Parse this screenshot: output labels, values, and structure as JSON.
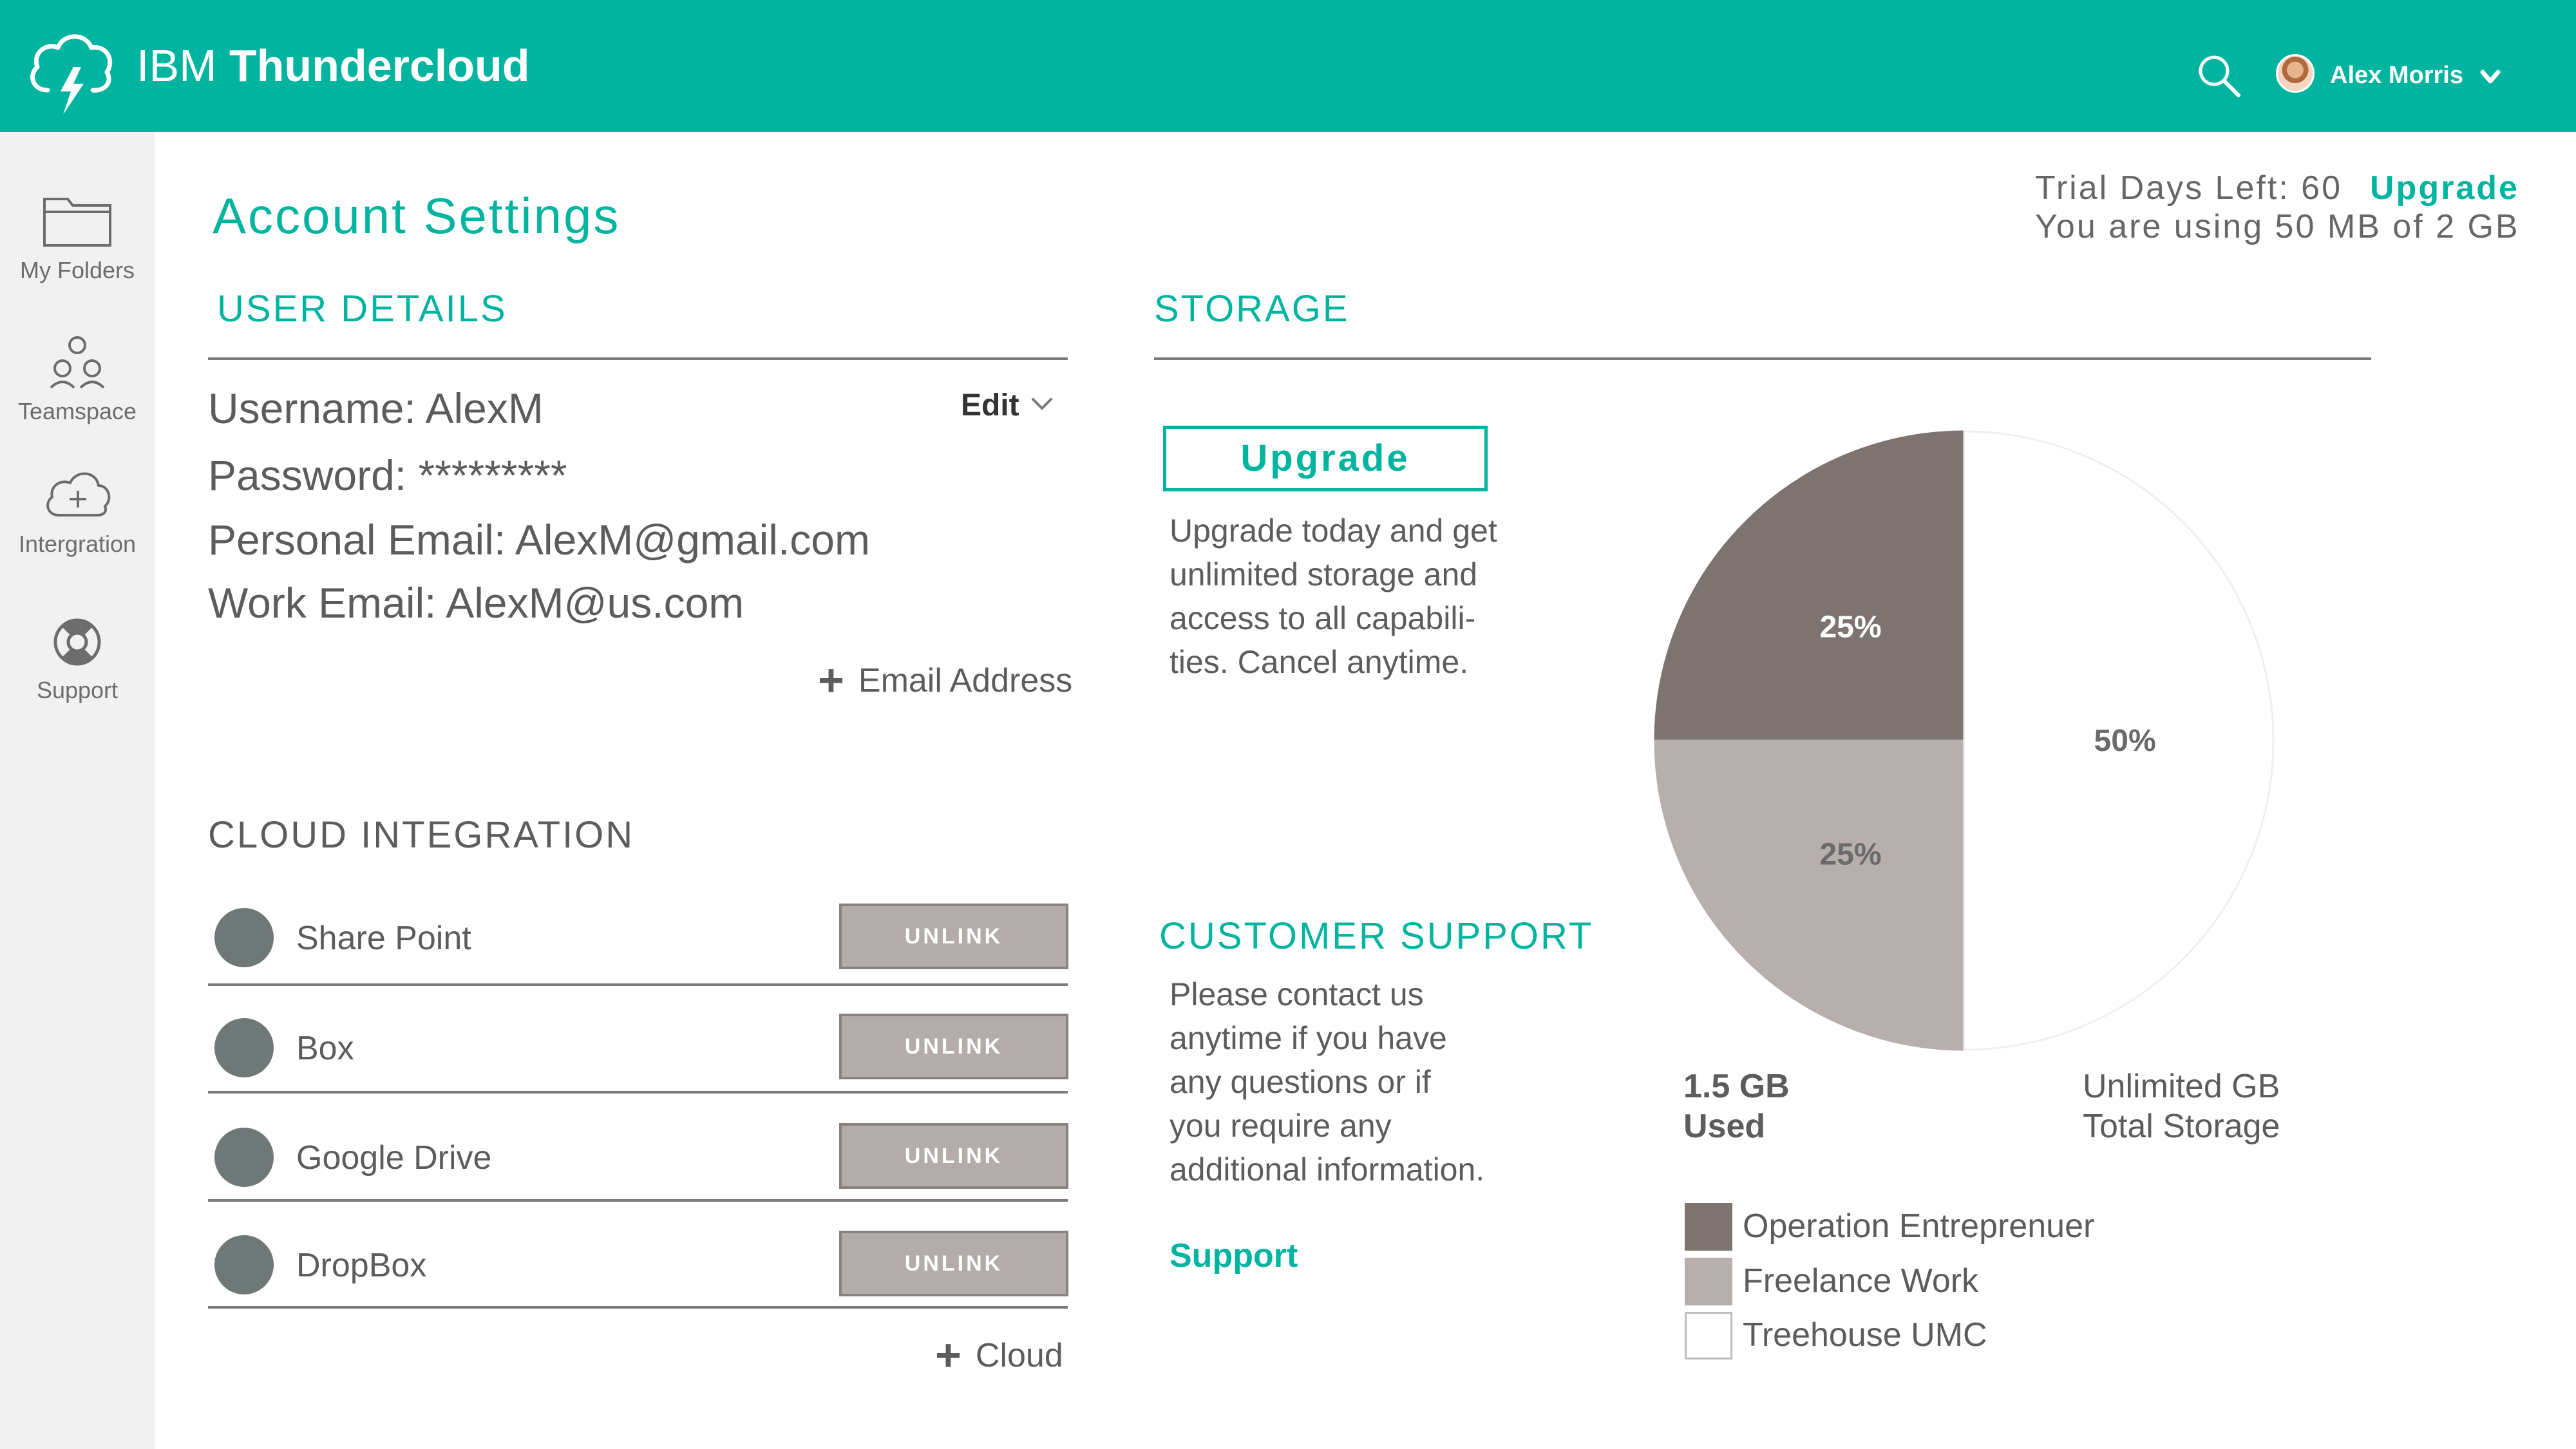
{
  "app": {
    "brand_light": "IBM",
    "brand_bold": "Thundercloud",
    "user_name": "Alex Morris",
    "accent_color": "#00b4a0"
  },
  "sidebar": {
    "items": [
      {
        "label": "My Folders",
        "icon": "folder-icon"
      },
      {
        "label": "Teamspace",
        "icon": "team-icon"
      },
      {
        "label": "Intergration",
        "icon": "cloud-plus-icon"
      },
      {
        "label": "Support",
        "icon": "lifebuoy-icon"
      }
    ]
  },
  "page": {
    "title": "Account Settings",
    "trial_label": "Trial Days Left: 60",
    "trial_upgrade": "Upgrade",
    "usage": "You are using 50 MB of 2 GB"
  },
  "user_details": {
    "title": "USER DETAILS",
    "edit_label": "Edit",
    "username": "Username: AlexM",
    "password": "Password: *********",
    "personal_email": "Personal Email: AlexM@gmail.com",
    "work_email": "Work Email: AlexM@us.com",
    "add_email": "Email Address"
  },
  "cloud_integration": {
    "title": "CLOUD INTEGRATION",
    "items": [
      {
        "name": "Share Point",
        "action": "UNLINK"
      },
      {
        "name": "Box",
        "action": "UNLINK"
      },
      {
        "name": "Google Drive",
        "action": "UNLINK"
      },
      {
        "name": "DropBox",
        "action": "UNLINK"
      }
    ],
    "add_cloud": "Cloud"
  },
  "storage": {
    "title": "STORAGE",
    "upgrade_button": "Upgrade",
    "upgrade_text": "Upgrade today and get\nunlimited storage and\naccess to all capabili-\nties. Cancel anytime.",
    "used_value": "1.5 GB",
    "used_label": "Used",
    "total_value": "Unlimited GB",
    "total_label": "Total Storage"
  },
  "customer_support": {
    "title": "CUSTOMER SUPPORT",
    "text": "Please contact us\nanytime if you have\nany questions or if\nyou require any\nadditional information.",
    "link": "Support"
  },
  "chart_data": {
    "type": "pie",
    "title": "",
    "series": [
      {
        "name": "Operation Entreprenuer",
        "value": 25,
        "label": "25%",
        "color": "#7d7371"
      },
      {
        "name": "Freelance Work",
        "value": 25,
        "label": "25%",
        "color": "#b7afad"
      },
      {
        "name": "Treehouse UMC",
        "value": 50,
        "label": "50%",
        "color": "#ffffff"
      }
    ],
    "legend_position": "bottom-left"
  }
}
